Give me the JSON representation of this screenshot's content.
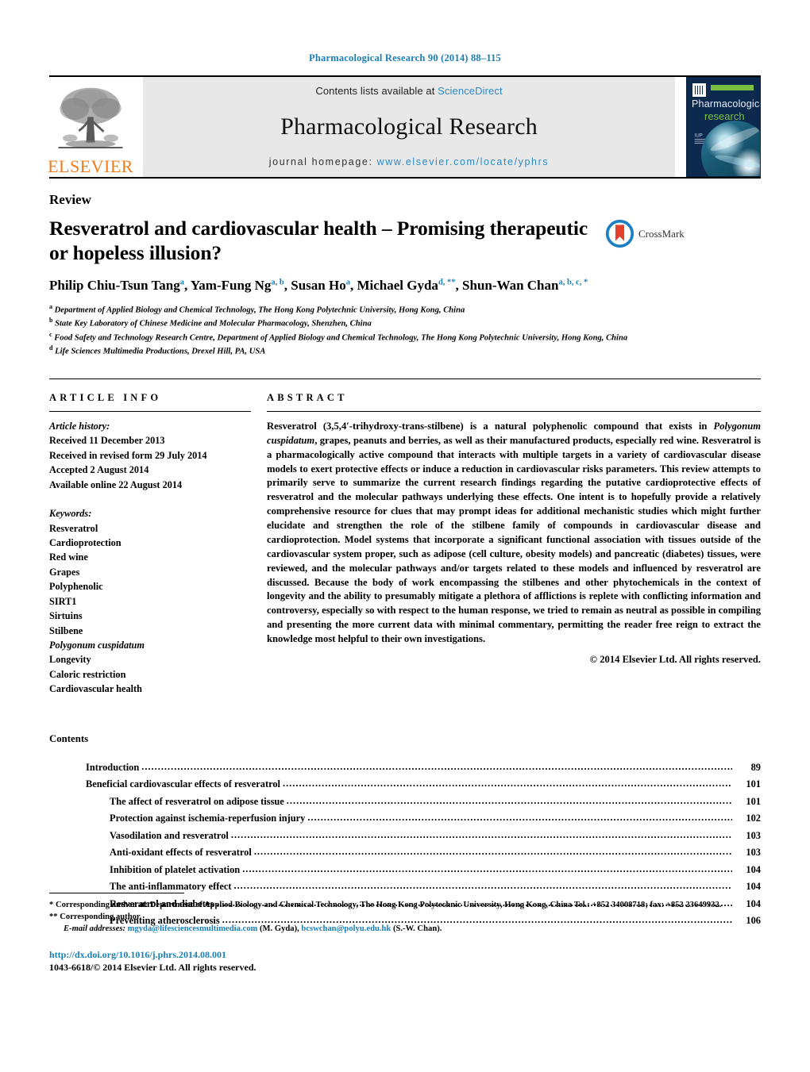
{
  "running_head": "Pharmacological Research 90 (2014) 88–115",
  "masthead": {
    "publisher_name": "ELSEVIER",
    "contents_prefix": "Contents lists available at",
    "contents_link": "ScienceDirect",
    "journal_title": "Pharmacological Research",
    "homepage_prefix": "journal homepage:",
    "homepage_url": "www.elsevier.com/locate/yphrs",
    "cover": {
      "line1": "Pharmacological",
      "line2": "research"
    },
    "link_color": "#2e8ac4",
    "elsevier_orange": "#f07c1b"
  },
  "article": {
    "type": "Review",
    "title": "Resveratrol and cardiovascular health – Promising therapeutic or hopeless illusion?",
    "authors": "Philip Chiu-Tsun Tang<sup>a</sup>, Yam-Fung Ng<sup>a, b</sup>, Susan Ho<sup>a</sup>, Michael Gyda<sup>d, **</sup>, Shun-Wan Chan<sup>a, b, c, *</sup>",
    "crossmark_label": "CrossMark",
    "affiliations": [
      "<sup>a</sup> Department of Applied Biology and Chemical Technology, The Hong Kong Polytechnic University, Hong Kong, China",
      "<sup>b</sup> State Key Laboratory of Chinese Medicine and Molecular Pharmacology, Shenzhen, China",
      "<sup>c</sup> Food Safety and Technology Research Centre, Department of Applied Biology and Chemical Technology, The Hong Kong Polytechnic University, Hong Kong, China",
      "<sup>d</sup> Life Sciences Multimedia Productions, Drexel Hill, PA, USA"
    ]
  },
  "article_info": {
    "heading": "ARTICLE INFO",
    "history_label": "Article history:",
    "history": [
      "Received 11 December 2013",
      "Received in revised form 29 July 2014",
      "Accepted 2 August 2014",
      "Available online 22 August 2014"
    ],
    "keywords_label": "Keywords:",
    "keywords": [
      "Resveratrol",
      "Cardioprotection",
      "Red wine",
      "Grapes",
      "Polyphenolic",
      "SIRT1",
      "Sirtuins",
      "Stilbene",
      "Polygonum cuspidatum",
      "Longevity",
      "Caloric restriction",
      "Cardiovascular health"
    ],
    "keywords_italic": [
      "Polygonum cuspidatum"
    ]
  },
  "abstract": {
    "heading": "ABSTRACT",
    "body": "Resveratrol (3,5,4′-trihydroxy-trans-stilbene) is a natural polyphenolic compound that exists in <i>Polygonum cuspidatum</i>, grapes, peanuts and berries, as well as their manufactured products, especially red wine. Resveratrol is a pharmacologically active compound that interacts with multiple targets in a variety of cardiovascular disease models to exert protective effects or induce a reduction in cardiovascular risks parameters. This review attempts to primarily serve to summarize the current research findings regarding the putative cardioprotective effects of resveratrol and the molecular pathways underlying these effects. One intent is to hopefully provide a relatively comprehensive resource for clues that may prompt ideas for additional mechanistic studies which might further elucidate and strengthen the role of the stilbene family of compounds in cardiovascular disease and cardioprotection. Model systems that incorporate a significant functional association with tissues outside of the cardiovascular system proper, such as adipose (cell culture, obesity models) and pancreatic (diabetes) tissues, were reviewed, and the molecular pathways and/or targets related to these models and influenced by resveratrol are discussed. Because the body of work encompassing the stilbenes and other phytochemicals in the context of longevity and the ability to presumably mitigate a plethora of afflictions is replete with conflicting information and controversy, especially so with respect to the human response, we tried to remain as neutral as possible in compiling and presenting the more current data with minimal commentary, permitting the reader free reign to extract the knowledge most helpful to their own investigations.",
    "copyright": "© 2014 Elsevier Ltd. All rights reserved."
  },
  "contents": {
    "heading": "Contents",
    "items": [
      {
        "label": "Introduction",
        "page": "89",
        "level": 1
      },
      {
        "label": "Beneficial cardiovascular effects of resveratrol",
        "page": "101",
        "level": 1
      },
      {
        "label": "The affect of resveratrol on adipose tissue",
        "page": "101",
        "level": 2
      },
      {
        "label": "Protection against ischemia-reperfusion injury",
        "page": "102",
        "level": 2
      },
      {
        "label": "Vasodilation and resveratrol",
        "page": "103",
        "level": 2
      },
      {
        "label": "Anti-oxidant effects of resveratrol",
        "page": "103",
        "level": 2
      },
      {
        "label": "Inhibition of platelet activation",
        "page": "104",
        "level": 2
      },
      {
        "label": "The anti-inflammatory effect",
        "page": "104",
        "level": 2
      },
      {
        "label": "Resveratrol and diabetes",
        "page": "104",
        "level": 2
      },
      {
        "label": "Preventing atherosclerosis",
        "page": "106",
        "level": 2
      }
    ]
  },
  "footnotes": {
    "corresponding_primary": "* Corresponding author at: Department of Applied Biology and Chemical Technology, The Hong Kong Polytechnic University, Hong Kong, China Tel.: +852 34008718; fax: +852 23649932.",
    "corresponding_secondary": "** Corresponding author.",
    "email_label": "E-mail addresses:",
    "email_1": "mgyda@lifesciencesmultimedia.com",
    "email_1_attr": "(M. Gyda)",
    "email_2": "bcswchan@polyu.edu.hk",
    "email_2_attr": "(S.-W. Chan).",
    "doi": "http://dx.doi.org/10.1016/j.phrs.2014.08.001",
    "issn": "1043-6618/© 2014 Elsevier Ltd. All rights reserved."
  }
}
